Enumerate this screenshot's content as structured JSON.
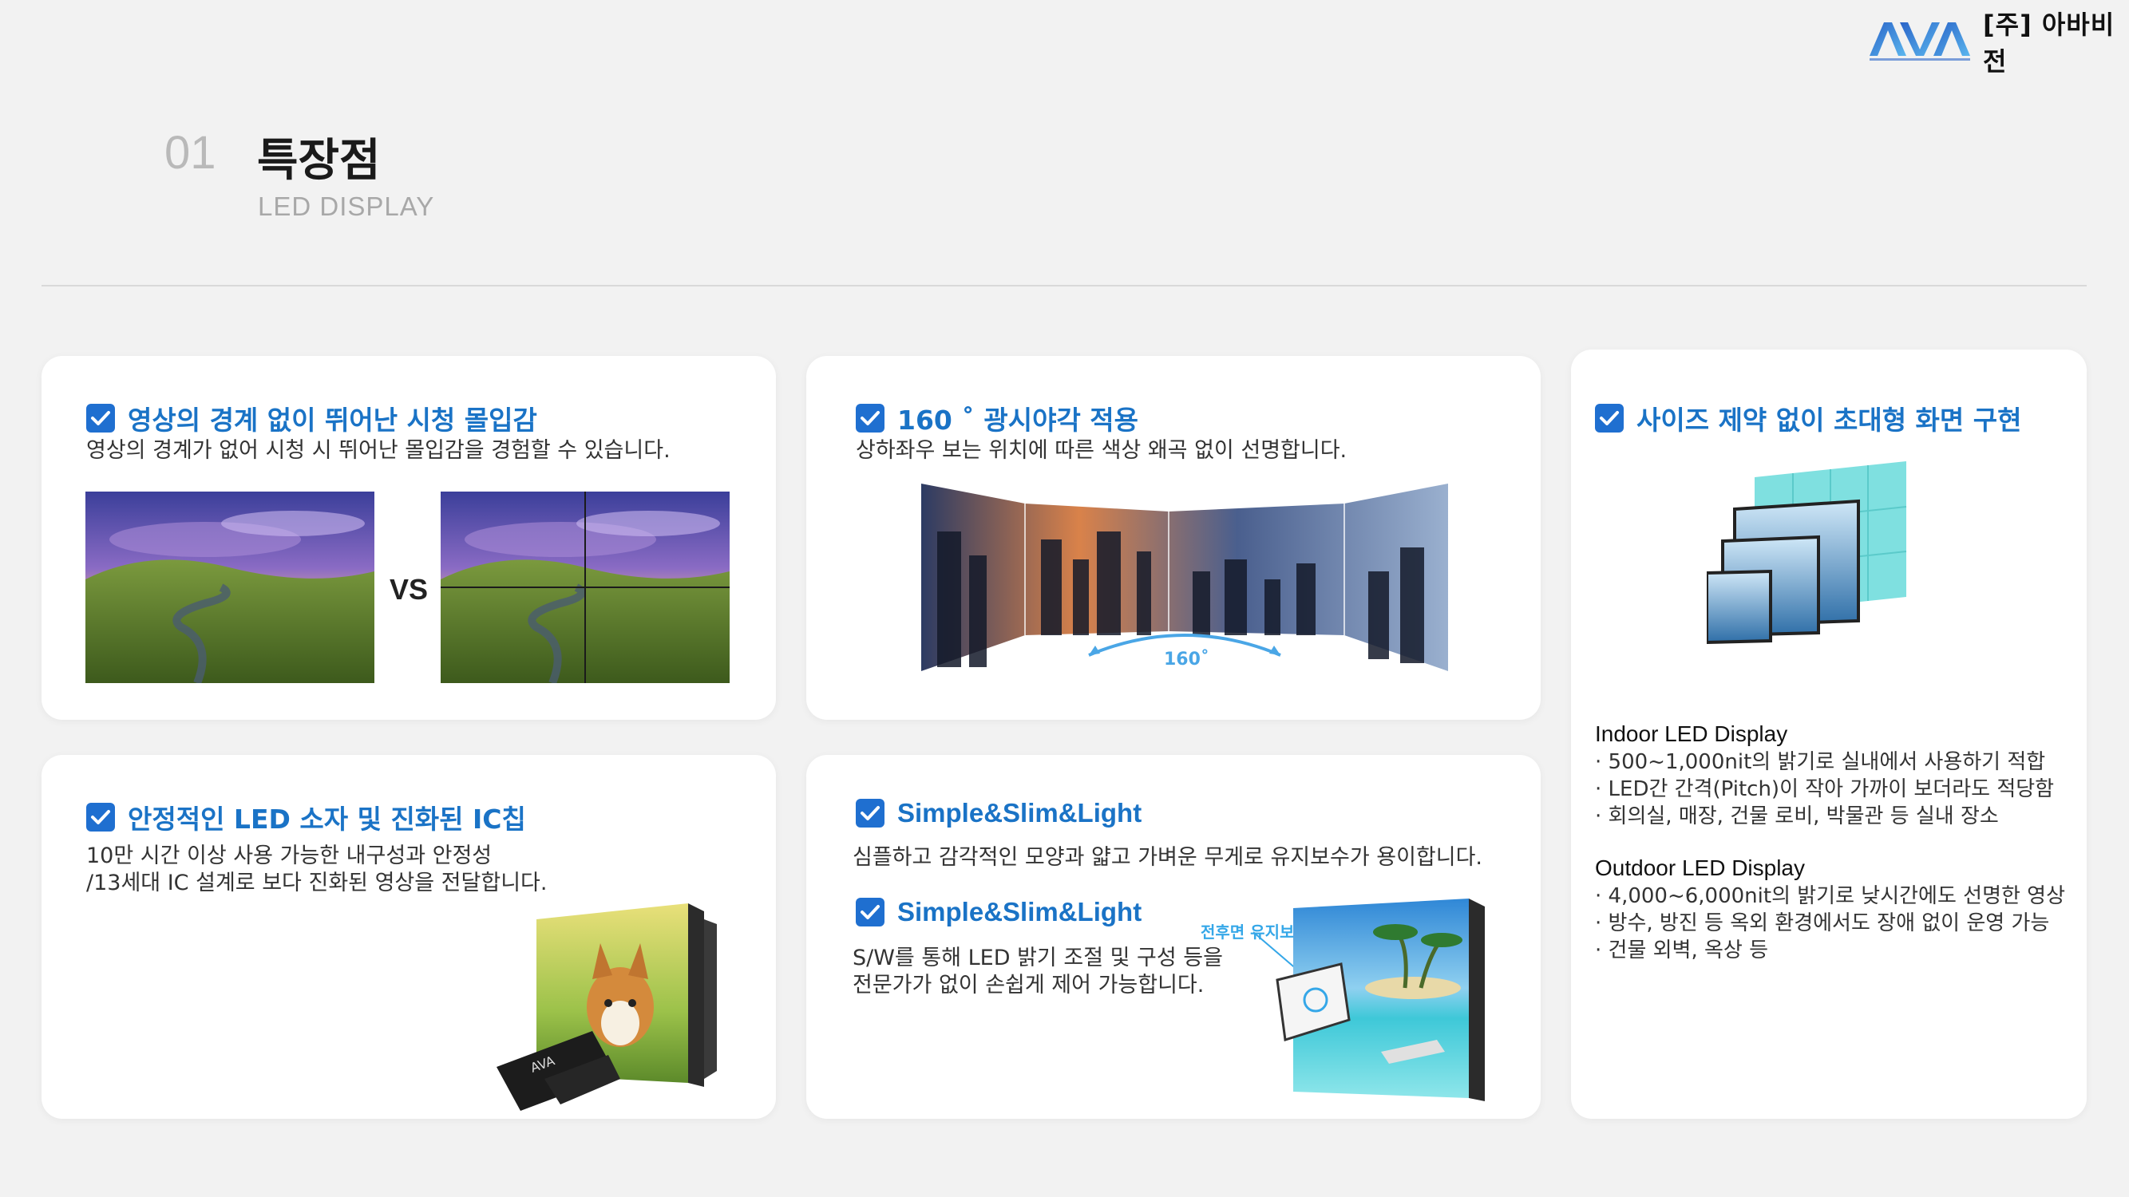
{
  "header": {
    "logo_mark": "AVA",
    "logo_text": "[주] 아바비전",
    "section_number": "01",
    "section_title": "특장점",
    "section_subtitle": "LED DISPLAY"
  },
  "cards": {
    "borderless": {
      "title": "영상의 경계 없이 뛰어난 시청 몰입감",
      "desc": "영상의 경계가 없어 시청 시 뛰어난 몰입감을 경험할 수 있습니다.",
      "vs_label": "VS"
    },
    "viewing_angle": {
      "title": "160 ˚ 광시야각 적용",
      "desc": "상하좌우 보는 위치에 따른 색상 왜곡 없이 선명합니다.",
      "angle_label": "160˚"
    },
    "size": {
      "title": "사이즈 제약 없이 초대형 화면 구현",
      "indoor_title": "Indoor LED Display",
      "indoor_items": [
        "· 500~1,000nit의 밝기로 실내에서 사용하기 적합",
        "· LED간 간격(Pitch)이 작아 가까이 보더라도 적당함",
        "· 회의실, 매장, 건물 로비, 박물관 등 실내 장소"
      ],
      "outdoor_title": "Outdoor LED Display",
      "outdoor_items": [
        "· 4,000~6,000nit의 밝기로 낮시간에도 선명한 영상",
        "· 방수, 방진 등 옥외 환경에서도 장애 없이 운영 가능",
        "· 건물 외벽, 옥상 등"
      ]
    },
    "ic_chip": {
      "title": "안정적인 LED 소자 및 진화된 IC칩",
      "desc_line1": "10만 시간 이상 사용 가능한 내구성과 안정성",
      "desc_line2": "/13세대 IC 설계로 보다 진화된 영상을 전달합니다."
    },
    "slim": {
      "title1": "Simple&Slim&Light",
      "desc1": "심플하고 감각적인 모양과 얇고 가벼운 무게로 유지보수가 용이합니다.",
      "title2": "Simple&Slim&Light",
      "desc2_line1": "S/W를 통해 LED 밝기 조절 및 구성 등을",
      "desc2_line2": "전문가가 없이 손쉽게 제어 가능합니다.",
      "callout": "전후면 유지보수"
    }
  },
  "colors": {
    "accent": "#1a73c6",
    "check_bg": "#1f6fd0",
    "page_bg": "#f2f2f2"
  }
}
